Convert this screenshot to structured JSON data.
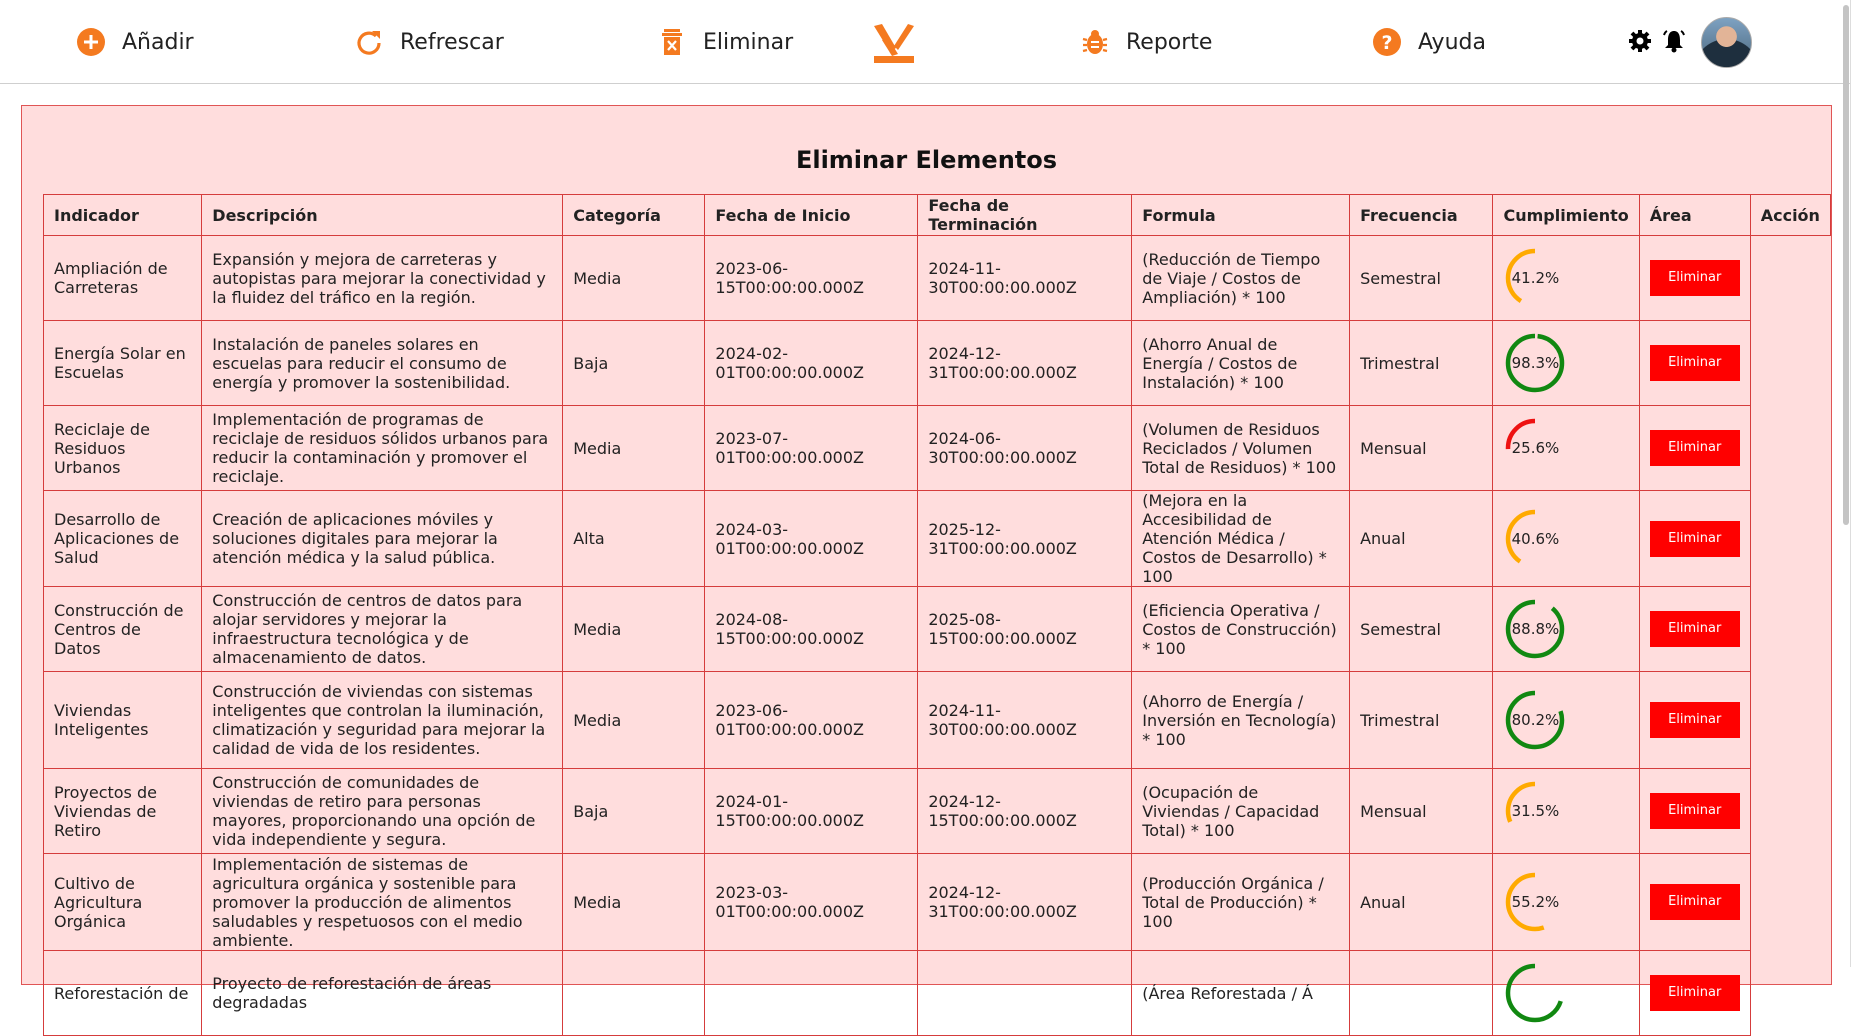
{
  "nav": {
    "add_label": "Añadir",
    "refresh_label": "Refrescar",
    "delete_label": "Eliminar",
    "report_label": "Reporte",
    "help_label": "Ayuda"
  },
  "colors": {
    "accent": "#f47a20",
    "panel_bg": "#ffdddd",
    "border": "#d53c3c",
    "button": "#ff0000",
    "good": "#118811",
    "warn": "#ffaa00",
    "bad": "#ee1111"
  },
  "page": {
    "title": "Eliminar Elementos"
  },
  "table": {
    "headers": [
      "Indicador",
      "Descripción",
      "Categoría",
      "Fecha de Inicio",
      "Fecha de Terminación",
      "Formula",
      "Frecuencia",
      "Cumplimiento",
      "Área",
      "Acción"
    ],
    "button_label": "Eliminar",
    "rows": [
      {
        "indicador": "Ampliación de Carreteras",
        "descripcion": "Expansión y mejora de carreteras y autopistas para mejorar la conectividad y la fluidez del tráfico en la región.",
        "categoria": "Media",
        "inicio": "2023-06-15T00:00:00.000Z",
        "fin": "2024-11-30T00:00:00.000Z",
        "formula": "(Reducción de Tiempo de Viaje / Costos de Ampliación) * 100",
        "frecuencia": "Semestral",
        "pct_label": "41.2%",
        "pct": 41.2,
        "color": "warn"
      },
      {
        "indicador": "Energía Solar en Escuelas",
        "descripcion": "Instalación de paneles solares en escuelas para reducir el consumo de energía y promover la sostenibilidad.",
        "categoria": "Baja",
        "inicio": "2024-02-01T00:00:00.000Z",
        "fin": "2024-12-31T00:00:00.000Z",
        "formula": "(Ahorro Anual de Energía / Costos de Instalación) * 100",
        "frecuencia": "Trimestral",
        "pct_label": "98.3%",
        "pct": 98.3,
        "color": "good"
      },
      {
        "indicador": "Reciclaje de Residuos Urbanos",
        "descripcion": "Implementación de programas de reciclaje de residuos sólidos urbanos para reducir la contaminación y promover el reciclaje.",
        "categoria": "Media",
        "inicio": "2023-07-01T00:00:00.000Z",
        "fin": "2024-06-30T00:00:00.000Z",
        "formula": "(Volumen de Residuos Reciclados / Volumen Total de Residuos) * 100",
        "frecuencia": "Mensual",
        "pct_label": "25.6%",
        "pct": 25.6,
        "color": "bad"
      },
      {
        "indicador": "Desarrollo de Aplicaciones de Salud",
        "descripcion": "Creación de aplicaciones móviles y soluciones digitales para mejorar la atención médica y la salud pública.",
        "categoria": "Alta",
        "inicio": "2024-03-01T00:00:00.000Z",
        "fin": "2025-12-31T00:00:00.000Z",
        "formula": "(Mejora en la Accesibilidad de Atención Médica / Costos de Desarrollo) * 100",
        "frecuencia": "Anual",
        "pct_label": "40.6%",
        "pct": 40.6,
        "color": "warn"
      },
      {
        "indicador": "Construcción de Centros de Datos",
        "descripcion": "Construcción de centros de datos para alojar servidores y mejorar la infraestructura tecnológica y de almacenamiento de datos.",
        "categoria": "Media",
        "inicio": "2024-08-15T00:00:00.000Z",
        "fin": "2025-08-15T00:00:00.000Z",
        "formula": "(Eficiencia Operativa / Costos de Construcción) * 100",
        "frecuencia": "Semestral",
        "pct_label": "88.8%",
        "pct": 88.8,
        "color": "good"
      },
      {
        "indicador": "Viviendas Inteligentes",
        "descripcion": "Construcción de viviendas con sistemas inteligentes que controlan la iluminación, climatización y seguridad para mejorar la calidad de vida de los residentes.",
        "categoria": "Media",
        "inicio": "2023-06-01T00:00:00.000Z",
        "fin": "2024-11-30T00:00:00.000Z",
        "formula": "(Ahorro de Energía / Inversión en Tecnología) * 100",
        "frecuencia": "Trimestral",
        "pct_label": "80.2%",
        "pct": 80.2,
        "color": "good"
      },
      {
        "indicador": "Proyectos de Viviendas de Retiro",
        "descripcion": "Construcción de comunidades de viviendas de retiro para personas mayores, proporcionando una opción de vida independiente y segura.",
        "categoria": "Baja",
        "inicio": "2024-01-15T00:00:00.000Z",
        "fin": "2024-12-15T00:00:00.000Z",
        "formula": "(Ocupación de Viviendas / Capacidad Total) * 100",
        "frecuencia": "Mensual",
        "pct_label": "31.5%",
        "pct": 31.5,
        "color": "warn"
      },
      {
        "indicador": "Cultivo de Agricultura Orgánica",
        "descripcion": "Implementación de sistemas de agricultura orgánica y sostenible para promover la producción de alimentos saludables y respetuosos con el medio ambiente.",
        "categoria": "Media",
        "inicio": "2023-03-01T00:00:00.000Z",
        "fin": "2024-12-31T00:00:00.000Z",
        "formula": "(Producción Orgánica / Total de Producción) * 100",
        "frecuencia": "Anual",
        "pct_label": "55.2%",
        "pct": 55.2,
        "color": "warn"
      },
      {
        "indicador": "Reforestación de",
        "descripcion": "Proyecto de reforestación de áreas degradadas",
        "categoria": "",
        "inicio": "",
        "fin": "",
        "formula": "(Área Reforestada / Á",
        "frecuencia": "",
        "pct_label": "",
        "pct": 70,
        "color": "good"
      }
    ]
  }
}
